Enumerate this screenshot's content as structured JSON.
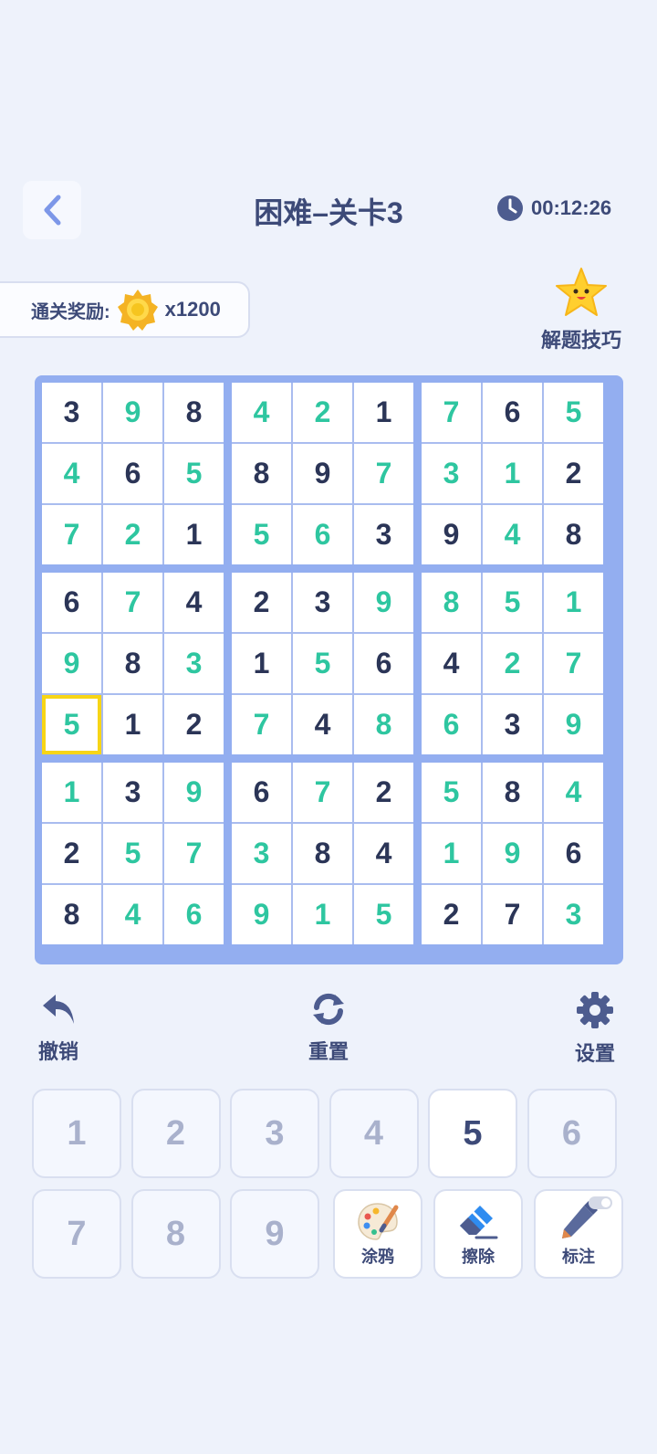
{
  "header": {
    "title": "困难–关卡3",
    "timer": "00:12:26"
  },
  "reward": {
    "label": "通关奖励:",
    "amount": "x1200"
  },
  "tips": {
    "label": "解题技巧"
  },
  "board": {
    "rows": [
      [
        3,
        9,
        8,
        4,
        2,
        1,
        7,
        6,
        5
      ],
      [
        4,
        6,
        5,
        8,
        9,
        7,
        3,
        1,
        2
      ],
      [
        7,
        2,
        1,
        5,
        6,
        3,
        9,
        4,
        8
      ],
      [
        6,
        7,
        4,
        2,
        3,
        9,
        8,
        5,
        1
      ],
      [
        9,
        8,
        3,
        1,
        5,
        6,
        4,
        2,
        7
      ],
      [
        5,
        1,
        2,
        7,
        4,
        8,
        6,
        3,
        9
      ],
      [
        1,
        3,
        9,
        6,
        7,
        2,
        5,
        8,
        4
      ],
      [
        2,
        5,
        7,
        3,
        8,
        4,
        1,
        9,
        6
      ],
      [
        8,
        4,
        6,
        9,
        1,
        5,
        2,
        7,
        3
      ]
    ],
    "filled_mask": [
      [
        0,
        1,
        0,
        1,
        1,
        0,
        1,
        0,
        1
      ],
      [
        1,
        0,
        1,
        0,
        0,
        1,
        1,
        1,
        0
      ],
      [
        1,
        1,
        0,
        1,
        1,
        0,
        0,
        1,
        0
      ],
      [
        0,
        1,
        0,
        0,
        0,
        1,
        1,
        1,
        1
      ],
      [
        1,
        0,
        1,
        0,
        1,
        0,
        0,
        1,
        1
      ],
      [
        1,
        0,
        0,
        1,
        0,
        1,
        1,
        0,
        1
      ],
      [
        1,
        0,
        1,
        0,
        1,
        0,
        1,
        0,
        1
      ],
      [
        0,
        1,
        1,
        1,
        0,
        0,
        1,
        1,
        0
      ],
      [
        0,
        1,
        1,
        1,
        1,
        1,
        0,
        0,
        1
      ]
    ],
    "selected_row": 5,
    "selected_col": 0
  },
  "tools": {
    "undo": "撤销",
    "reset": "重置",
    "settings": "设置"
  },
  "keypad": {
    "numbers": [
      "1",
      "2",
      "3",
      "4",
      "5",
      "6",
      "7",
      "8",
      "9"
    ],
    "active_number": "5",
    "doodle": "涂鸦",
    "erase": "擦除",
    "mark": "标注"
  },
  "colors": {
    "given": "#2b3557",
    "filled": "#2ec6a0",
    "accent": "#3d4a78",
    "board_border": "#93aef0",
    "selected": "#f7d516"
  }
}
